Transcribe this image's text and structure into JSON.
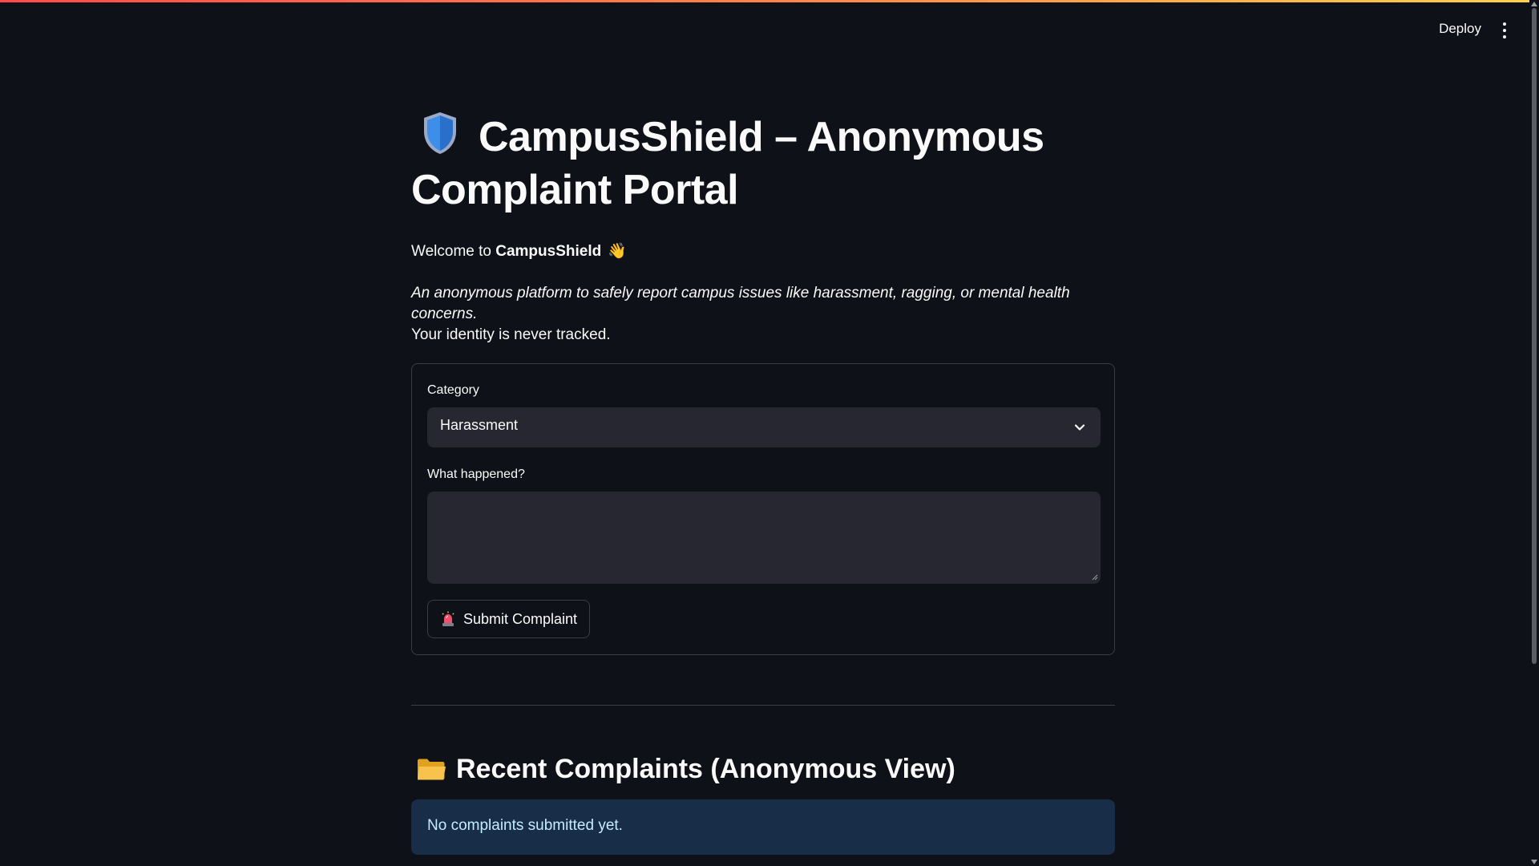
{
  "header": {
    "deploy_label": "Deploy",
    "menu_icon": "kebab-menu-icon"
  },
  "main": {
    "title": "CampusShield – Anonymous Complaint Portal",
    "title_icon": "shield-icon",
    "welcome_prefix": "Welcome to ",
    "welcome_brand": "CampusShield",
    "welcome_icon": "waving-hand-icon",
    "tagline": "An anonymous platform to safely report campus issues like harassment, ragging, or mental health concerns.",
    "identity_note": "Your identity is never tracked."
  },
  "form": {
    "category_label": "Category",
    "category_value": "Harassment",
    "what_label": "What happened?",
    "what_value": "",
    "submit_label": "Submit Complaint",
    "submit_icon": "siren-icon"
  },
  "recent": {
    "title": "Recent Complaints (Anonymous View)",
    "title_icon": "folder-icon",
    "empty_message": "No complaints submitted yet."
  },
  "colors": {
    "background": "#0e1117",
    "input_bg": "#262730",
    "info_bg": "#172d48",
    "info_text": "#c7ebff",
    "accent_gradient_start": "#ff4b4b",
    "accent_gradient_end": "#ffd24b"
  }
}
